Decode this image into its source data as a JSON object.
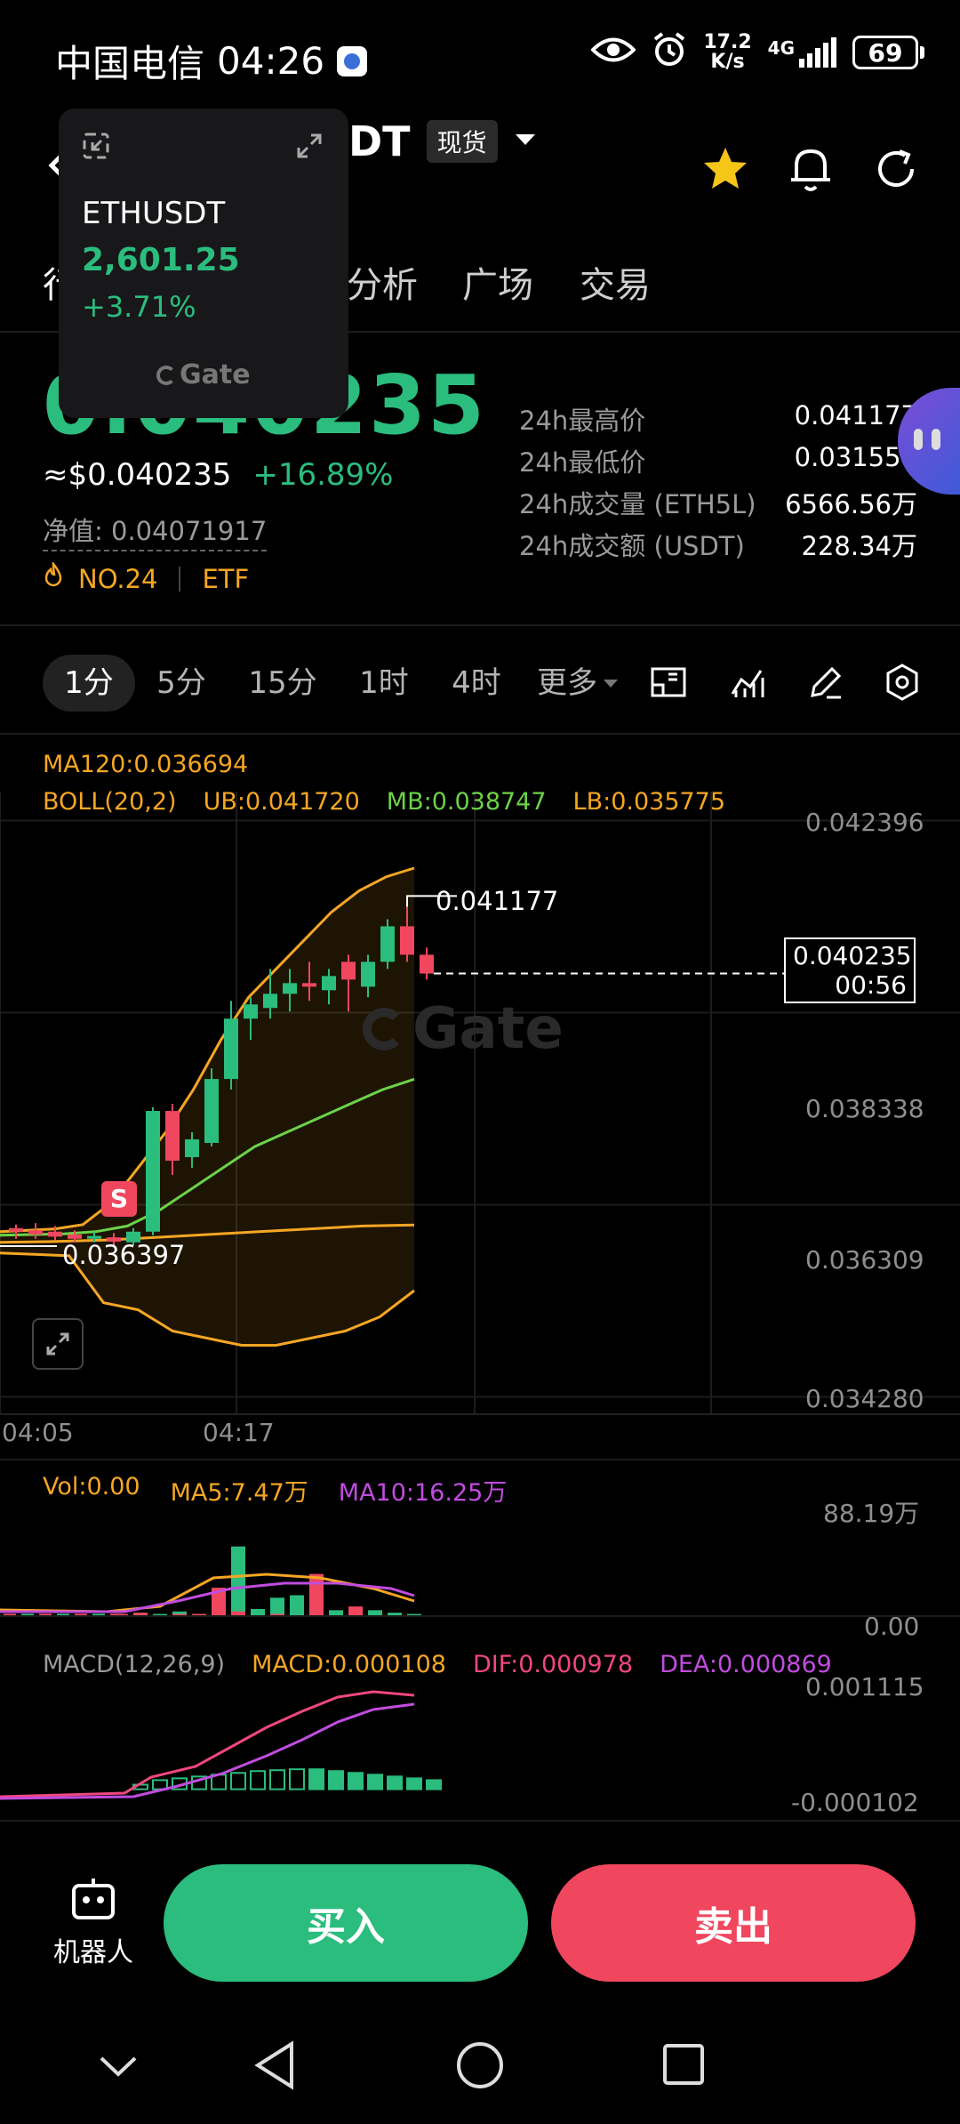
{
  "status_bar": {
    "carrier": "中国电信",
    "time": "04:26",
    "net_speed_top": "17.2",
    "net_speed_bottom": "K/s",
    "net_type": "4G",
    "battery": "69"
  },
  "header": {
    "pair_visible": "DT",
    "market_badge": "现货"
  },
  "float_card": {
    "symbol": "ETHUSDT",
    "price": "2,601.25",
    "change": "+3.71%",
    "brand": "Gate"
  },
  "tabs": [
    {
      "label": "行"
    },
    {
      "label": "分析"
    },
    {
      "label": "广场"
    },
    {
      "label": "交易"
    }
  ],
  "price_info": {
    "big_price": "0.040235",
    "usd_price": "≈$0.040235",
    "change": "+16.89%",
    "nav_label": "净值: 0.04071917",
    "rank": "NO.24",
    "tag": "ETF"
  },
  "stats": [
    {
      "label": "24h最高价",
      "value": "0.041177"
    },
    {
      "label": "24h最低价",
      "value": "0.031558"
    },
    {
      "label": "24h成交量 (ETH5L)",
      "value": "6566.56万"
    },
    {
      "label": "24h成交额 (USDT)",
      "value": "228.34万"
    }
  ],
  "timeframes": [
    {
      "label": "1分",
      "active": true
    },
    {
      "label": "5分"
    },
    {
      "label": "15分"
    },
    {
      "label": "1时"
    },
    {
      "label": "4时"
    },
    {
      "label": "更多"
    }
  ],
  "chart_legend": {
    "ma120": "MA120:0.036694",
    "boll": "BOLL(20,2)",
    "ub": "UB:0.041720",
    "mb": "MB:0.038747",
    "lb": "LB:0.035775"
  },
  "chart_axis": {
    "y_ticks": [
      "0.042396",
      "0.038338",
      "0.036309",
      "0.034280"
    ],
    "x_ticks": [
      "04:05",
      "04:17"
    ],
    "high_marker": "0.041177",
    "low_marker": "0.036397",
    "current_price": "0.040235",
    "countdown": "00:56",
    "signal": "S",
    "watermark": "Gate"
  },
  "volume_legend": {
    "vol": "Vol:0.00",
    "ma5": "MA5:7.47万",
    "ma10": "MA10:16.25万",
    "y_top": "88.19万",
    "y_bottom": "0.00"
  },
  "macd_legend": {
    "params": "MACD(12,26,9)",
    "macd": "MACD:0.000108",
    "dif": "DIF:0.000978",
    "dea": "DEA:0.000869",
    "y_top": "0.001115",
    "y_bottom": "-0.000102"
  },
  "bottom_bar": {
    "robot_label": "机器人",
    "buy": "买入",
    "sell": "卖出"
  },
  "colors": {
    "up": "#2bbd7e",
    "down": "#f0475e",
    "accent": "#f5a623"
  },
  "chart_data": {
    "type": "candlestick",
    "x_ticks": [
      "04:05",
      "04:17"
    ],
    "ylim": [
      0.03428,
      0.042396
    ],
    "y_ticks": [
      0.042396,
      0.038338,
      0.036309,
      0.03428
    ],
    "annotations": {
      "high": 0.041177,
      "low": 0.036397,
      "current": 0.040235
    },
    "candles": [
      {
        "o": 0.03665,
        "c": 0.0366,
        "h": 0.0367,
        "l": 0.0365
      },
      {
        "o": 0.03662,
        "c": 0.03656,
        "h": 0.03672,
        "l": 0.0365
      },
      {
        "o": 0.0366,
        "c": 0.03653,
        "h": 0.03668,
        "l": 0.03648
      },
      {
        "o": 0.03656,
        "c": 0.0365,
        "h": 0.03662,
        "l": 0.03645
      },
      {
        "o": 0.0365,
        "c": 0.03654,
        "h": 0.0366,
        "l": 0.03645
      },
      {
        "o": 0.03652,
        "c": 0.03646,
        "h": 0.03658,
        "l": 0.0364
      },
      {
        "o": 0.03645,
        "c": 0.0366,
        "h": 0.03665,
        "l": 0.0364
      },
      {
        "o": 0.0366,
        "c": 0.0383,
        "h": 0.03835,
        "l": 0.03655
      },
      {
        "o": 0.0383,
        "c": 0.0376,
        "h": 0.0384,
        "l": 0.0374
      },
      {
        "o": 0.03765,
        "c": 0.0379,
        "h": 0.038,
        "l": 0.0375
      },
      {
        "o": 0.03785,
        "c": 0.03875,
        "h": 0.0389,
        "l": 0.0378
      },
      {
        "o": 0.03875,
        "c": 0.0396,
        "h": 0.03985,
        "l": 0.0386
      },
      {
        "o": 0.0396,
        "c": 0.0398,
        "h": 0.0399,
        "l": 0.0393
      },
      {
        "o": 0.03975,
        "c": 0.03995,
        "h": 0.0403,
        "l": 0.0396
      },
      {
        "o": 0.03995,
        "c": 0.0401,
        "h": 0.0403,
        "l": 0.0397
      },
      {
        "o": 0.0401,
        "c": 0.04005,
        "h": 0.0404,
        "l": 0.03985
      },
      {
        "o": 0.04,
        "c": 0.0402,
        "h": 0.0403,
        "l": 0.0398
      },
      {
        "o": 0.0404,
        "c": 0.04015,
        "h": 0.0405,
        "l": 0.0397
      },
      {
        "o": 0.04005,
        "c": 0.0404,
        "h": 0.0405,
        "l": 0.0399
      },
      {
        "o": 0.0404,
        "c": 0.0409,
        "h": 0.041,
        "l": 0.0403
      },
      {
        "o": 0.0409,
        "c": 0.0405,
        "h": 0.041177,
        "l": 0.0404
      },
      {
        "o": 0.0405,
        "c": 0.040235,
        "h": 0.0406,
        "l": 0.04015
      }
    ],
    "bollinger": {
      "ub": [
        0.0366,
        0.03662,
        0.03664,
        0.0367,
        0.037,
        0.0375,
        0.038,
        0.0386,
        0.0393,
        0.0399,
        0.0403,
        0.0407,
        0.0411,
        0.0414,
        0.0416,
        0.04172
      ],
      "mb": [
        0.03655,
        0.03656,
        0.03657,
        0.0366,
        0.03668,
        0.0369,
        0.0372,
        0.0375,
        0.0378,
        0.038,
        0.0382,
        0.0384,
        0.0386,
        0.038747
      ],
      "lb": [
        0.0363,
        0.03628,
        0.03626,
        0.0356,
        0.0355,
        0.0352,
        0.0351,
        0.035,
        0.035,
        0.0351,
        0.0352,
        0.0354,
        0.03577
      ]
    },
    "ma120": [
      0.03645,
      0.03646,
      0.03648,
      0.03652,
      0.03656,
      0.0366,
      0.03664,
      0.03668,
      0.036694
    ],
    "volume": {
      "up": [
        2,
        1,
        3,
        1,
        8,
        55,
        5,
        14,
        16,
        3,
        4,
        5,
        4,
        2,
        1
      ],
      "down": [
        1,
        2,
        0,
        1,
        1,
        22,
        3,
        0,
        1,
        0,
        33,
        0,
        7,
        0,
        0
      ],
      "ylim": [
        0,
        88.19
      ]
    },
    "macd": {
      "ylim": [
        -0.000102,
        0.001115
      ],
      "y_ticks": [
        0.001115,
        -0.000102
      ]
    }
  }
}
